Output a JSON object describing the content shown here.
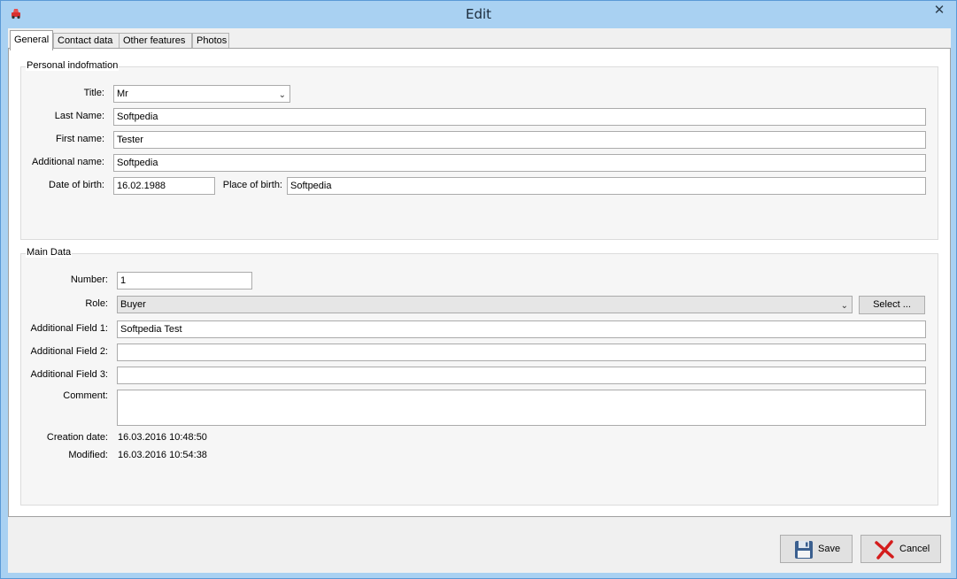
{
  "window": {
    "title": "Edit",
    "close_glyph": "✕"
  },
  "tabs": [
    {
      "label": "General"
    },
    {
      "label": "Contact data"
    },
    {
      "label": "Other features"
    },
    {
      "label": "Photos"
    }
  ],
  "personal": {
    "legend": "Personal indofmation",
    "title_label": "Title:",
    "title_value": "Mr",
    "last_name_label": "Last Name:",
    "last_name_value": "Softpedia",
    "first_name_label": "First name:",
    "first_name_value": "Tester",
    "additional_name_label": "Additional name:",
    "additional_name_value": "Softpedia",
    "dob_label": "Date of birth:",
    "dob_value": "16.02.1988",
    "pob_label": "Place of birth:",
    "pob_value": "Softpedia"
  },
  "main": {
    "legend": "Main Data",
    "number_label": "Number:",
    "number_value": "1",
    "role_label": "Role:",
    "role_value": "Buyer",
    "select_label": "Select ...",
    "af1_label": "Additional Field 1:",
    "af1_value": "Softpedia Test",
    "af2_label": "Additional Field 2:",
    "af2_value": "",
    "af3_label": "Additional Field 3:",
    "af3_value": "",
    "comment_label": "Comment:",
    "comment_value": "",
    "creation_label": "Creation date:",
    "creation_value": "16.03.2016  10:48:50",
    "modified_label": "Modified:",
    "modified_value": "16.03.2016  10:54:38"
  },
  "buttons": {
    "save": "Save",
    "cancel": "Cancel"
  },
  "icons": {
    "app": "car-icon",
    "save": "floppy-disk-icon",
    "cancel": "red-x-icon"
  }
}
